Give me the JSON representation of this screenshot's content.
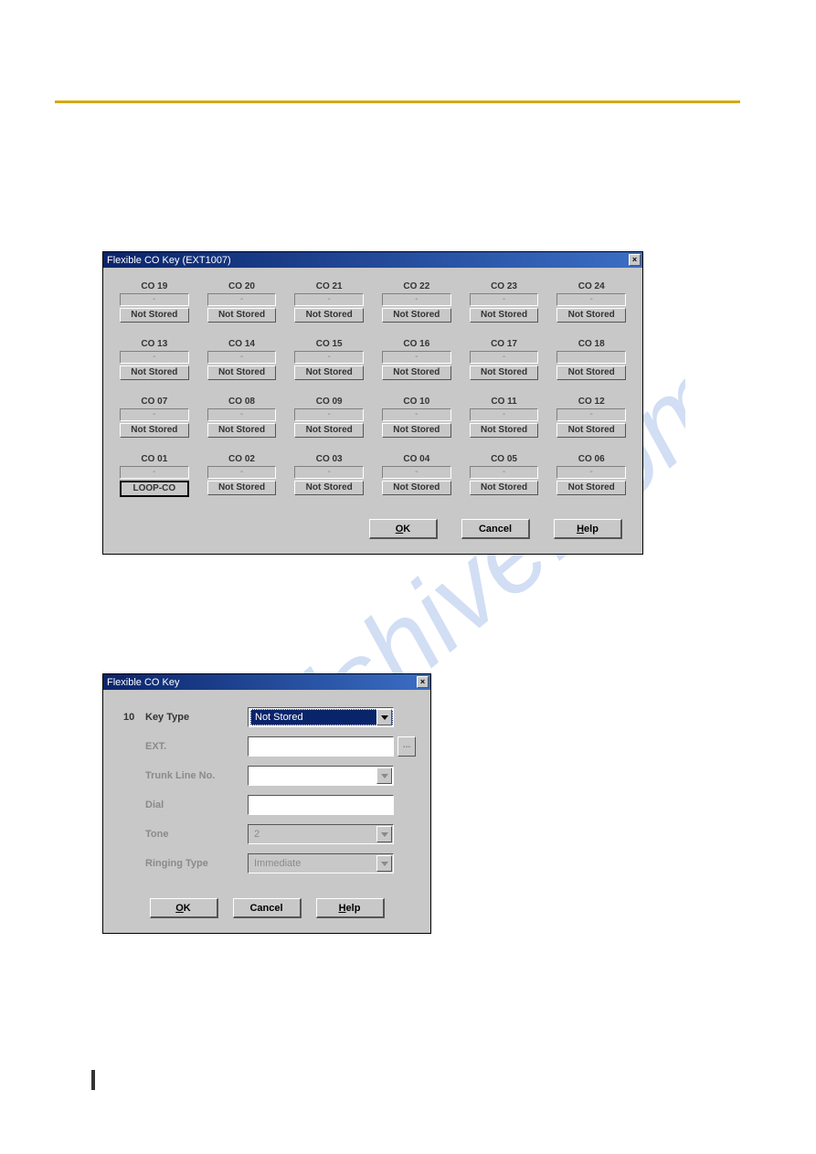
{
  "dialog1": {
    "title": "Flexible CO Key (EXT1007)",
    "rows": [
      [
        {
          "label": "CO 19",
          "dash": "-",
          "status": "Not Stored"
        },
        {
          "label": "CO 20",
          "dash": "-",
          "status": "Not Stored"
        },
        {
          "label": "CO 21",
          "dash": "-",
          "status": "Not Stored"
        },
        {
          "label": "CO 22",
          "dash": "-",
          "status": "Not Stored"
        },
        {
          "label": "CO 23",
          "dash": "-",
          "status": "Not Stored"
        },
        {
          "label": "CO 24",
          "dash": "-",
          "status": "Not Stored"
        }
      ],
      [
        {
          "label": "CO 13",
          "dash": "-",
          "status": "Not Stored"
        },
        {
          "label": "CO 14",
          "dash": "-",
          "status": "Not Stored"
        },
        {
          "label": "CO 15",
          "dash": "-",
          "status": "Not Stored"
        },
        {
          "label": "CO 16",
          "dash": "-",
          "status": "Not Stored"
        },
        {
          "label": "CO 17",
          "dash": "-",
          "status": "Not Stored"
        },
        {
          "label": "CO 18",
          "dash": "",
          "status": "Not Stored"
        }
      ],
      [
        {
          "label": "CO 07",
          "dash": "-",
          "status": "Not Stored"
        },
        {
          "label": "CO 08",
          "dash": "-",
          "status": "Not Stored"
        },
        {
          "label": "CO 09",
          "dash": "-",
          "status": "Not Stored"
        },
        {
          "label": "CO 10",
          "dash": "-",
          "status": "Not Stored"
        },
        {
          "label": "CO 11",
          "dash": "-",
          "status": "Not Stored"
        },
        {
          "label": "CO 12",
          "dash": "-",
          "status": "Not Stored"
        }
      ],
      [
        {
          "label": "CO 01",
          "dash": "-",
          "status": "LOOP-CO",
          "loop": true
        },
        {
          "label": "CO 02",
          "dash": "-",
          "status": "Not Stored"
        },
        {
          "label": "CO 03",
          "dash": "-",
          "status": "Not Stored"
        },
        {
          "label": "CO 04",
          "dash": "-",
          "status": "Not Stored"
        },
        {
          "label": "CO 05",
          "dash": "-",
          "status": "Not Stored"
        },
        {
          "label": "CO 06",
          "dash": "-",
          "status": "Not Stored"
        }
      ]
    ],
    "buttons": {
      "ok": "OK",
      "cancel": "Cancel",
      "help": "Help"
    }
  },
  "dialog2": {
    "title": "Flexible CO Key",
    "number": "10",
    "fields": {
      "key_type": {
        "label": "Key Type",
        "value": "Not Stored"
      },
      "ext": {
        "label": "EXT.",
        "value": ""
      },
      "trunk": {
        "label": "Trunk Line No.",
        "value": ""
      },
      "dial": {
        "label": "Dial",
        "value": ""
      },
      "tone": {
        "label": "Tone",
        "value": "2"
      },
      "ringing": {
        "label": "Ringing Type",
        "value": "Immediate"
      }
    },
    "ellipsis": "...",
    "buttons": {
      "ok": "OK",
      "cancel": "Cancel",
      "help": "Help"
    }
  }
}
